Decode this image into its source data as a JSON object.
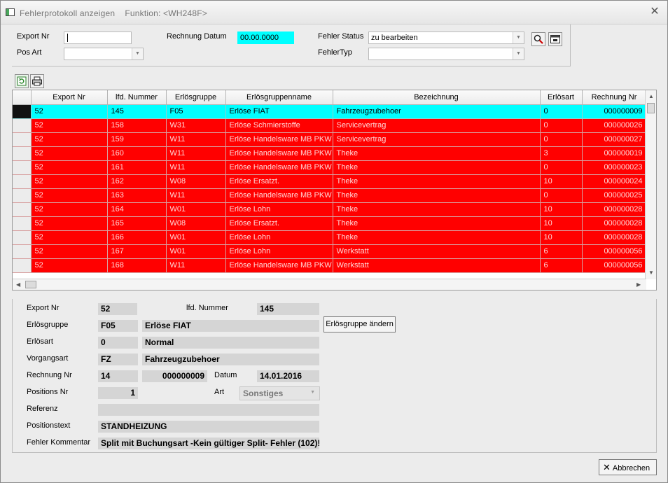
{
  "window": {
    "title": "Fehlerprotokoll anzeigen",
    "function_label": "Funktion: <WH248F>"
  },
  "filters": {
    "export_nr_label": "Export Nr",
    "export_nr_value": "",
    "pos_art_label": "Pos Art",
    "pos_art_value": "",
    "rechnung_datum_label": "Rechnung Datum",
    "rechnung_datum_value": "00.00.0000",
    "fehler_status_label": "Fehler Status",
    "fehler_status_value": "zu bearbeiten",
    "fehler_typ_label": "FehlerTyp",
    "fehler_typ_value": ""
  },
  "grid": {
    "columns": [
      "Export Nr",
      "lfd. Nummer",
      "Erlösgruppe",
      "Erlösgruppenname",
      "Bezeichnung",
      "Erlösart",
      "Rechnung Nr"
    ],
    "rows": [
      [
        "52",
        "145",
        "F05",
        "Erlöse FIAT",
        "Fahrzeugzubehoer",
        "0",
        "000000009"
      ],
      [
        "52",
        "158",
        "W31",
        "Erlöse Schmierstoffe",
        "Servicevertrag",
        "0",
        "000000026"
      ],
      [
        "52",
        "159",
        "W11",
        "Erlöse Handelsware MB PKW",
        "Servicevertrag",
        "0",
        "000000027"
      ],
      [
        "52",
        "160",
        "W11",
        "Erlöse Handelsware MB PKW",
        "Theke",
        "3",
        "000000019"
      ],
      [
        "52",
        "161",
        "W11",
        "Erlöse Handelsware MB PKW",
        "Theke",
        "0",
        "000000023"
      ],
      [
        "52",
        "162",
        "W08",
        "Erlöse Ersatzt.",
        "Theke",
        "10",
        "000000024"
      ],
      [
        "52",
        "163",
        "W11",
        "Erlöse Handelsware MB PKW",
        "Theke",
        "0",
        "000000025"
      ],
      [
        "52",
        "164",
        "W01",
        "Erlöse Lohn",
        "Theke",
        "10",
        "000000028"
      ],
      [
        "52",
        "165",
        "W08",
        "Erlöse Ersatzt.",
        "Theke",
        "10",
        "000000028"
      ],
      [
        "52",
        "166",
        "W01",
        "Erlöse Lohn",
        "Theke",
        "10",
        "000000028"
      ],
      [
        "52",
        "167",
        "W01",
        "Erlöse Lohn",
        "Werkstatt",
        "6",
        "000000056"
      ],
      [
        "52",
        "168",
        "W11",
        "Erlöse Handelsware MB PKW",
        "Werkstatt",
        "6",
        "000000056"
      ]
    ],
    "selected_row": 0
  },
  "detail": {
    "export_nr_label": "Export Nr",
    "export_nr": "52",
    "lfd_nummer_label": "lfd. Nummer",
    "lfd_nummer": "145",
    "erloesgruppe_label": "Erlösgruppe",
    "erloesgruppe_code": "F05",
    "erloesgruppe_name": "Erlöse FIAT",
    "erloesgruppe_button": "Erlösgruppe ändern",
    "erloesart_label": "Erlösart",
    "erloesart_code": "0",
    "erloesart_name": "Normal",
    "vorgangsart_label": "Vorgangsart",
    "vorgangsart_code": "FZ",
    "vorgangsart_name": "Fahrzeugzubehoer",
    "rechnung_nr_label": "Rechnung Nr",
    "rechnung_nr_a": "14",
    "rechnung_nr_b": "000000009",
    "datum_label": "Datum",
    "datum": "14.01.2016",
    "positions_nr_label": "Positions Nr",
    "positions_nr": "1",
    "art_label": "Art",
    "art_value": "Sonstiges",
    "referenz_label": "Referenz",
    "referenz": "",
    "positionstext_label": "Positionstext",
    "positionstext": "STANDHEIZUNG",
    "fehler_kommentar_label": "Fehler Kommentar",
    "fehler_kommentar": "Split mit Buchungsart -Kein gültiger Split- Fehler (102)!"
  },
  "footer": {
    "cancel_label": "Abbrechen"
  }
}
